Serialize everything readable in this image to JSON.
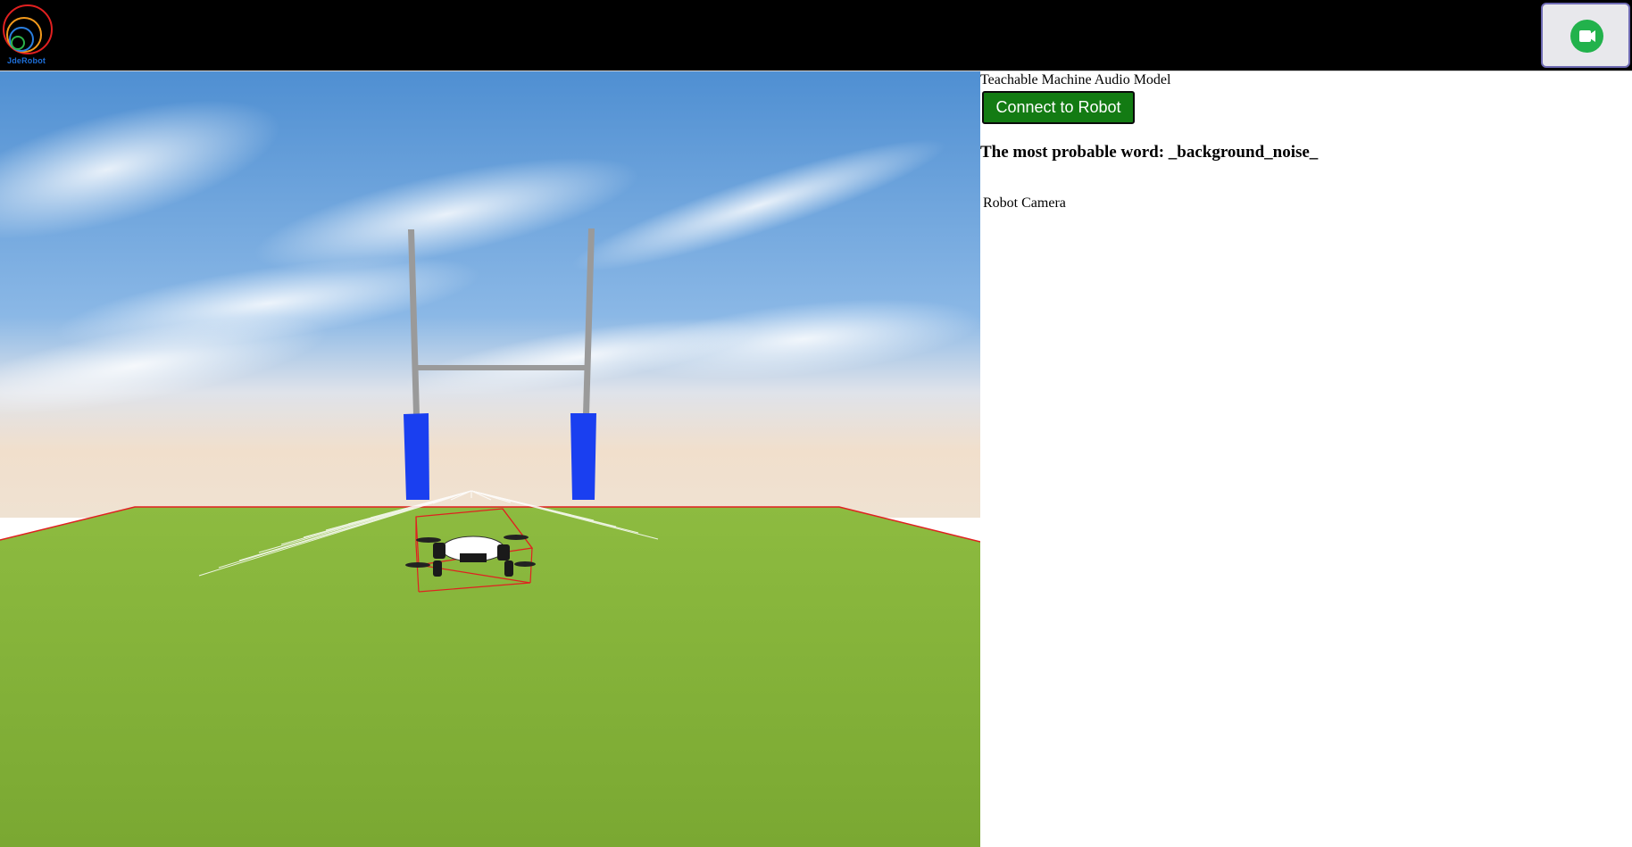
{
  "header": {
    "logo_text": "JdeRobot",
    "camera_button_icon": "video-camera-icon",
    "accent_color": "#22b24c"
  },
  "panel": {
    "title": "Teachable Machine Audio Model",
    "connect_button_label": "Connect to Robot",
    "probable_word_label": "The most probable word: _background_noise_",
    "camera_label": "Robot Camera"
  },
  "scene": {
    "description_icon": "3d-simulation-view",
    "ground_color": "#7fae3a",
    "sky_color": "#6aa4d8",
    "post_color": "#1a3ff0"
  }
}
